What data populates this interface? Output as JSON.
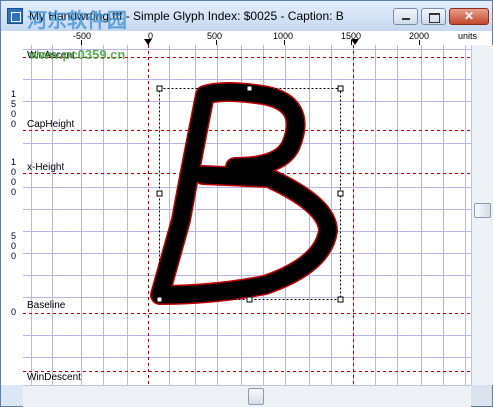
{
  "window": {
    "title": "My Handwrting.ttf - Simple Glyph Index: $0025 - Caption: B",
    "watermark": "河东软件园",
    "watermark_url": "www.pc0359.cn",
    "close_glyph": "✕"
  },
  "ruler_top": {
    "labels": [
      "-500",
      "0",
      "500",
      "1000",
      "1500",
      "2000"
    ],
    "units": "units"
  },
  "ruler_left": {
    "groups": [
      [
        "1",
        "5",
        "0",
        "0"
      ],
      [
        "1",
        "0",
        "0",
        "0"
      ],
      [
        "5",
        "0",
        "0"
      ],
      [
        "0"
      ]
    ]
  },
  "metrics": {
    "ascent": "WinAscent",
    "cap_height": "CapHeight",
    "x_height": "x-Height",
    "baseline": "Baseline",
    "descent": "WinDescent"
  },
  "colors": {
    "grid": "#b9b6e6",
    "metric_line": "#c00000",
    "glyph": "#000000",
    "canvas_bg": "#ffffff"
  },
  "icons": [
    "app-icon",
    "minimize-icon",
    "maximize-icon",
    "close-icon"
  ]
}
